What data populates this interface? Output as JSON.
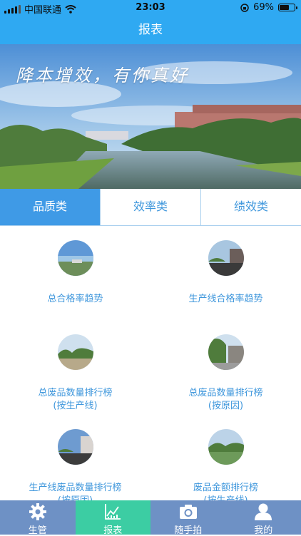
{
  "status": {
    "carrier": "中国联通",
    "time": "23:03",
    "battery": "69%",
    "battery_level": 0.69
  },
  "header": {
    "title": "报表"
  },
  "banner": {
    "slogan": "降本增效，有你真好"
  },
  "tabs": [
    {
      "label": "品质类",
      "active": true
    },
    {
      "label": "效率类",
      "active": false
    },
    {
      "label": "绩效类",
      "active": false
    }
  ],
  "reports": [
    {
      "line1": "总合格率趋势",
      "line2": ""
    },
    {
      "line1": "生产线合格率趋势",
      "line2": ""
    },
    {
      "line1": "总废品数量排行榜",
      "line2": "(按生产线)"
    },
    {
      "line1": "总废品数量排行榜",
      "line2": "(按原因)"
    },
    {
      "line1": "生产线废品数量排行榜",
      "line2": "(按原因)"
    },
    {
      "line1": "废品金额排行榜",
      "line2": "(按生产线)"
    }
  ],
  "nav": [
    {
      "label": "生管",
      "icon": "gear-icon"
    },
    {
      "label": "报表",
      "icon": "chart-icon",
      "active": true
    },
    {
      "label": "随手拍",
      "icon": "camera-icon"
    },
    {
      "label": "我的",
      "icon": "user-icon"
    }
  ],
  "colors": {
    "primary": "#2fa9f2",
    "tab_active": "#3f9ae6",
    "text_blue": "#3f97dc",
    "nav_bg": "#6e91c5",
    "nav_active": "#3ccda3"
  }
}
